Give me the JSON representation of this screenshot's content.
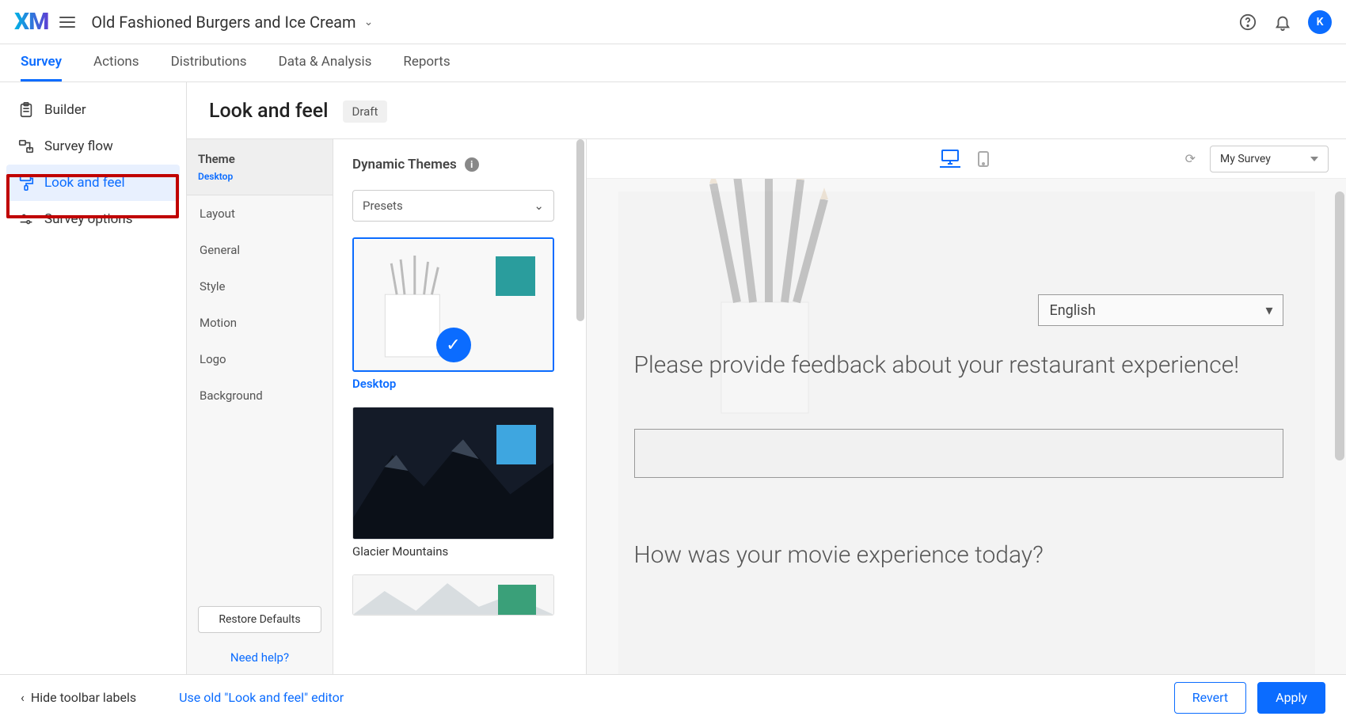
{
  "header": {
    "logo": "XM",
    "project_name": "Old Fashioned Burgers and Ice Cream",
    "avatar_initial": "K"
  },
  "top_tabs": {
    "items": [
      "Survey",
      "Actions",
      "Distributions",
      "Data & Analysis",
      "Reports"
    ],
    "active": 0
  },
  "sidebar": {
    "items": [
      {
        "label": "Builder"
      },
      {
        "label": "Survey flow"
      },
      {
        "label": "Look and feel"
      },
      {
        "label": "Survey options"
      }
    ]
  },
  "page": {
    "title": "Look and feel",
    "status_badge": "Draft"
  },
  "sections": {
    "group_title": "Theme",
    "group_sub": "Desktop",
    "items": [
      "Layout",
      "General",
      "Style",
      "Motion",
      "Logo",
      "Background"
    ],
    "restore_label": "Restore Defaults",
    "help_label": "Need help?"
  },
  "theme_picker": {
    "title": "Dynamic Themes",
    "preset_label": "Presets",
    "themes": [
      {
        "label": "Desktop",
        "swatch": "#2a9d9d",
        "selected": true
      },
      {
        "label": "Glacier Mountains",
        "swatch": "#3ea6e0",
        "selected": false
      },
      {
        "label": "",
        "swatch": "#3aa079",
        "selected": false
      }
    ]
  },
  "preview": {
    "survey_select": "My Survey",
    "language": "English",
    "q1": "Please provide feedback about your restaurant experience!",
    "q2": "How was your movie experience today?"
  },
  "footer": {
    "hide_labels": "Hide toolbar labels",
    "old_editor": "Use old \"Look and feel\" editor",
    "revert": "Revert",
    "apply": "Apply"
  }
}
